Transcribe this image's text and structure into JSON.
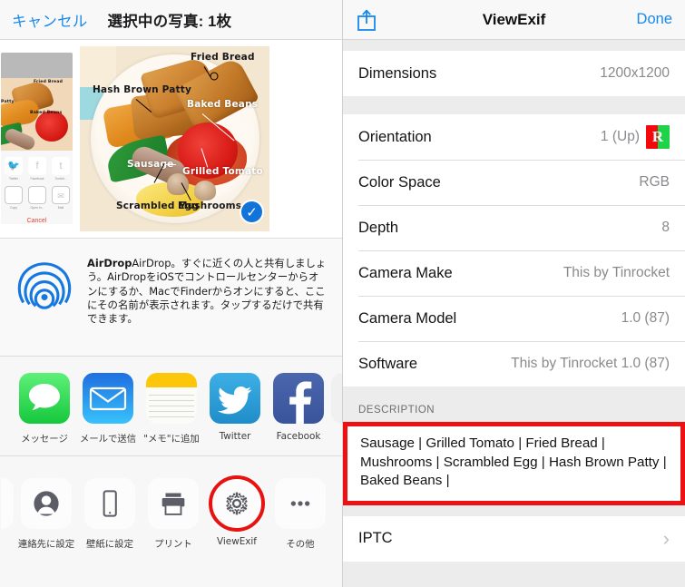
{
  "share_sheet": {
    "navbar": {
      "cancel_label": "キャンセル",
      "title": "選択中の写真: 1枚"
    },
    "photo": {
      "selected_checkmark": "✓",
      "annotations": [
        "Fried Bread",
        "Hash Brown Patty",
        "Baked Beans",
        "Sausage",
        "Grilled Tomato",
        "Scrambled Egg",
        "Mushrooms"
      ],
      "thumbnail_labels": {
        "fried_bread": "Fried Bread",
        "hash_brown_patty": "Patty",
        "baked_beans": "Baked Beans",
        "twitter": "Twitter",
        "facebook": "Facebook",
        "tumblr": "Tumblr...",
        "copy": "Copy",
        "open_in": "Open In...",
        "mail": "Mail",
        "cancel": "Cancel"
      }
    },
    "airdrop": {
      "title": "AirDrop",
      "body": "AirDrop。すぐに近くの人と共有しましょう。AirDropをiOSでコントロールセンターからオンにするか、MacでFinderからオンにすると、ここにその名前が表示されます。タップするだけで共有できます。"
    },
    "apps": [
      {
        "label": "メッセージ",
        "icon": "messages-icon"
      },
      {
        "label": "メールで送信",
        "icon": "mail-icon"
      },
      {
        "label": "\"メモ\"に追加",
        "icon": "notes-icon"
      },
      {
        "label": "Twitter",
        "icon": "twitter-icon"
      },
      {
        "label": "Facebook",
        "icon": "facebook-icon"
      }
    ],
    "actions": [
      {
        "label": "連絡先に設定",
        "icon": "contact-icon",
        "highlighted": false
      },
      {
        "label": "壁紙に設定",
        "icon": "wallpaper-icon",
        "highlighted": false
      },
      {
        "label": "プリント",
        "icon": "printer-icon",
        "highlighted": false
      },
      {
        "label": "ViewExif",
        "icon": "viewexif-snowflake-icon",
        "highlighted": true
      },
      {
        "label": "その他",
        "icon": "more-ellipsis-icon",
        "highlighted": false
      }
    ]
  },
  "viewexif": {
    "navbar": {
      "share_icon": "share-icon",
      "title": "ViewExif",
      "done_label": "Done"
    },
    "rows": [
      {
        "key": "Dimensions",
        "value": "1200x1200"
      },
      {
        "key": "Orientation",
        "value": "1 (Up)",
        "badge": "R"
      },
      {
        "key": "Color Space",
        "value": "RGB"
      },
      {
        "key": "Depth",
        "value": "8"
      },
      {
        "key": "Camera Make",
        "value": "This by Tinrocket"
      },
      {
        "key": "Camera Model",
        "value": "1.0 (87)"
      },
      {
        "key": "Software",
        "value": "This by Tinrocket 1.0 (87)"
      }
    ],
    "description": {
      "header": "DESCRIPTION",
      "text": "Sausage | Grilled Tomato | Fried Bread | Mushrooms | Scrambled Egg | Hash Brown Patty | Baked Beans |"
    },
    "iptc": {
      "label": "IPTC",
      "chevron": "›"
    }
  },
  "colors": {
    "accent_blue": "#1589ee",
    "highlight_red": "#ee1113",
    "orientation_red": "#f3090b",
    "orientation_green": "#1ed24a"
  }
}
